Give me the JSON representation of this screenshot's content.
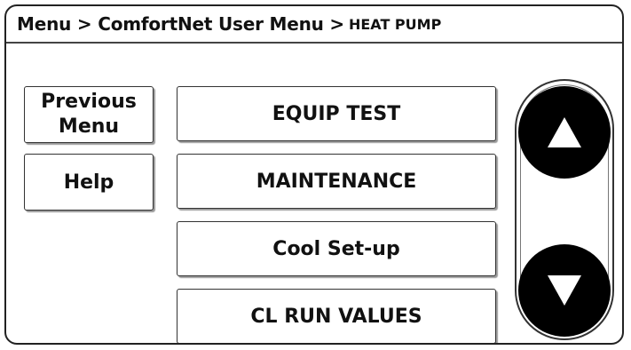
{
  "breadcrumb": {
    "main": "Menu > ComfortNet User Menu >",
    "current": "HEAT PUMP"
  },
  "left_buttons": {
    "previous_line1": "Previous",
    "previous_line2": "Menu",
    "help": "Help"
  },
  "menu_items": [
    "EQUIP TEST",
    "MAINTENANCE",
    "Cool Set-up",
    "CL RUN VALUES"
  ],
  "scroll": {
    "up_icon": "triangle-up-icon",
    "down_icon": "triangle-down-icon"
  },
  "colors": {
    "border": "#333333",
    "arrow_fill": "#000000",
    "background": "#ffffff"
  }
}
